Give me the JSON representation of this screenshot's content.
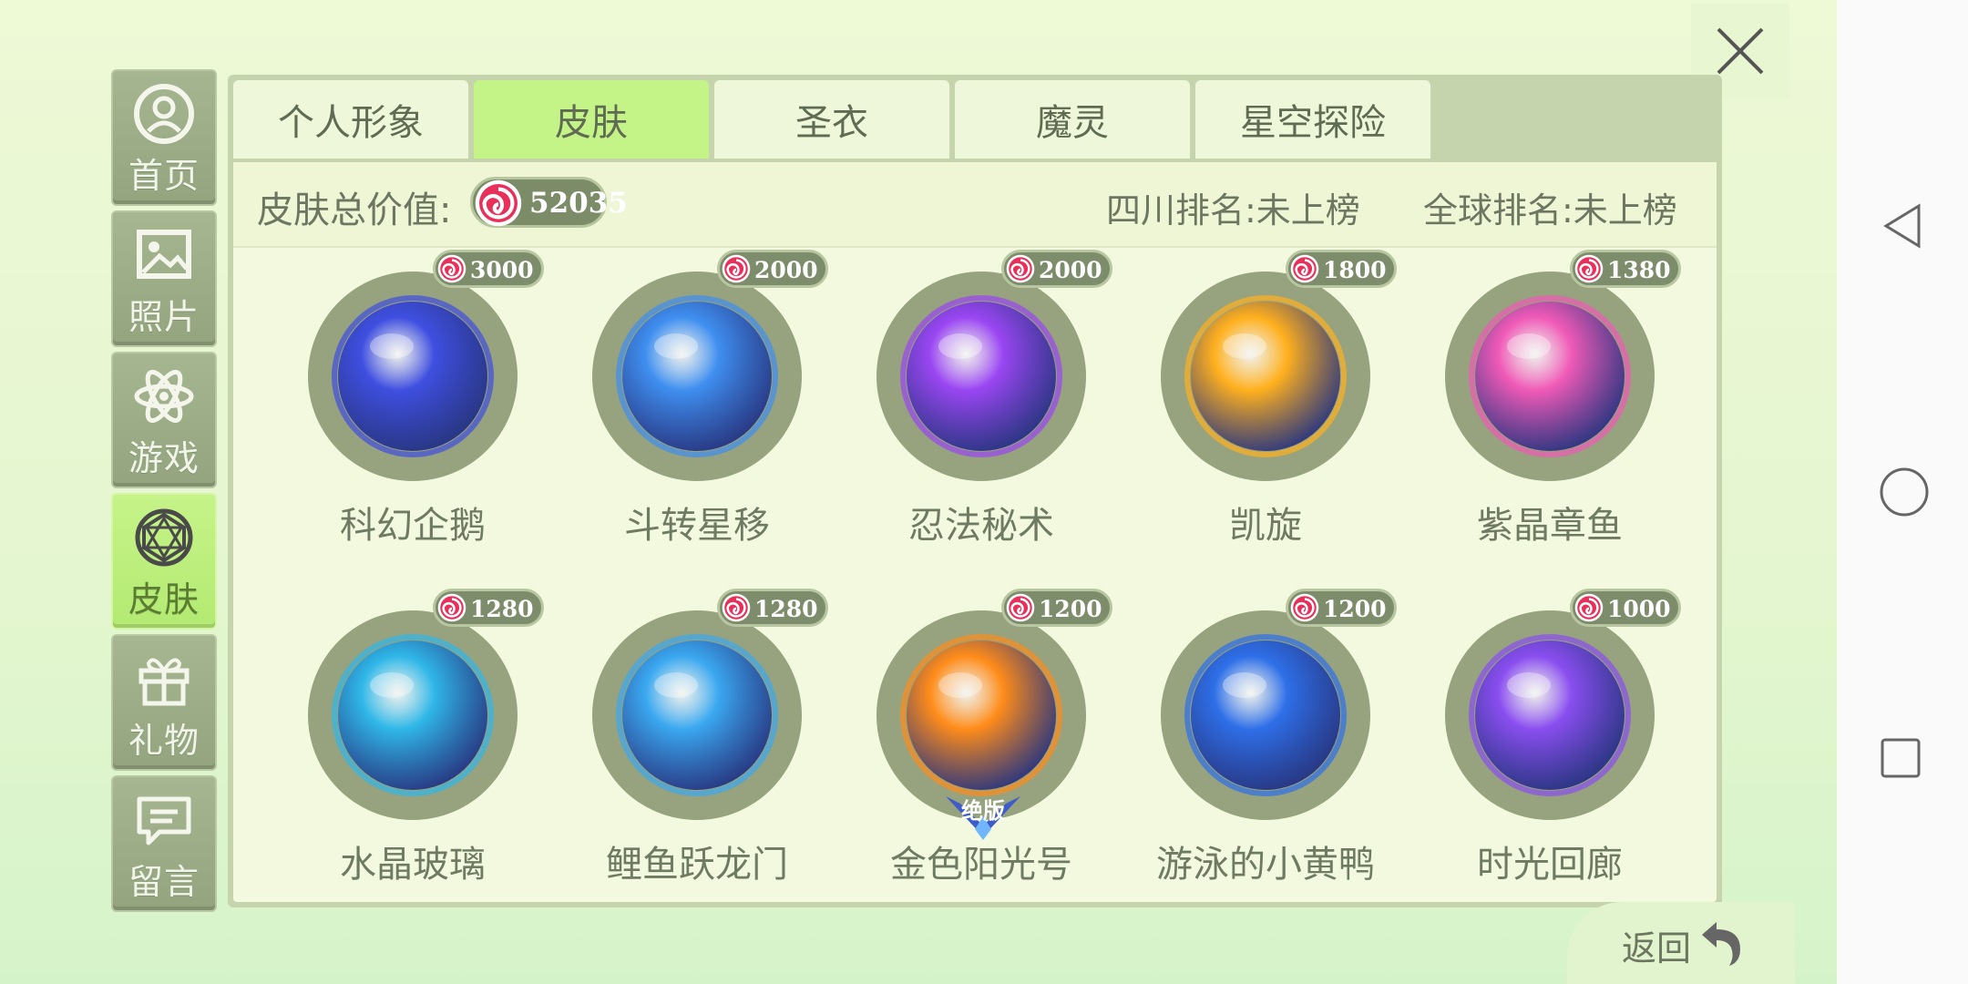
{
  "close_icon": "close-icon",
  "sidebar": {
    "items": [
      {
        "label": "首页",
        "icon": "home-user-icon",
        "active": false
      },
      {
        "label": "照片",
        "icon": "photo-icon",
        "active": false
      },
      {
        "label": "游戏",
        "icon": "atom-icon",
        "active": false
      },
      {
        "label": "皮肤",
        "icon": "gem-icon",
        "active": true
      },
      {
        "label": "礼物",
        "icon": "gift-icon",
        "active": false
      },
      {
        "label": "留言",
        "icon": "message-icon",
        "active": false
      }
    ]
  },
  "tabs": [
    {
      "label": "个人形象",
      "active": false
    },
    {
      "label": "皮肤",
      "active": true
    },
    {
      "label": "圣衣",
      "active": false
    },
    {
      "label": "魔灵",
      "active": false
    },
    {
      "label": "星空探险",
      "active": false
    }
  ],
  "summary": {
    "total_label": "皮肤总价值:",
    "total_value": "52035",
    "sichuan_rank": "四川排名:未上榜",
    "global_rank": "全球排名:未上榜"
  },
  "skins": [
    {
      "name": "科幻企鹅",
      "price": "3000",
      "color": "#3f4fe0"
    },
    {
      "name": "斗转星移",
      "price": "2000",
      "color": "#3f8ff0"
    },
    {
      "name": "忍法秘术",
      "price": "2000",
      "color": "#9a46f2"
    },
    {
      "name": "凯旋",
      "price": "1800",
      "color": "#ffb01e"
    },
    {
      "name": "紫晶章鱼",
      "price": "1380",
      "color": "#f05ab7"
    },
    {
      "name": "水晶玻璃",
      "price": "1280",
      "color": "#2fb7e8"
    },
    {
      "name": "鲤鱼跃龙门",
      "price": "1280",
      "color": "#3aa8f0"
    },
    {
      "name": "金色阳光号",
      "price": "1200",
      "color": "#ff8c1a",
      "badge": "绝版"
    },
    {
      "name": "游泳的小黄鸭",
      "price": "1200",
      "color": "#2e6fe8"
    },
    {
      "name": "时光回廊",
      "price": "1000",
      "color": "#8a4ef0"
    }
  ],
  "back": {
    "label": "返回",
    "icon": "return-arrow-icon"
  },
  "system_nav": {
    "back": "triangle-back-icon",
    "home": "circle-home-icon",
    "recents": "square-recents-icon"
  }
}
